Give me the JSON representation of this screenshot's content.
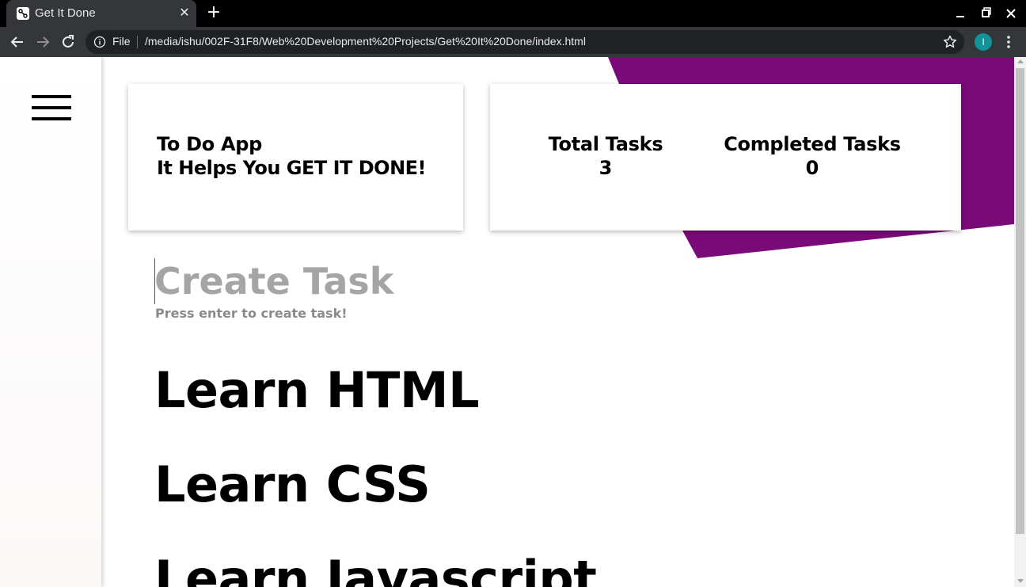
{
  "browser": {
    "tab_title": "Get It Done",
    "tab_close_label": "✕",
    "new_tab_label": "+",
    "file_label": "File",
    "url": "/media/ishu/002F-31F8/Web%20Development%20Projects/Get%20It%20Done/index.html",
    "profile_initial": "I",
    "profile_color": "#12939a"
  },
  "colors": {
    "accent_purple": "#7a0a78",
    "card_bg": "#ffffff",
    "placeholder_gray": "#a5a5a5"
  },
  "intro_card": {
    "title": "To Do App",
    "subtitle": "It Helps You GET IT DONE!"
  },
  "stats": {
    "total_label": "Total Tasks",
    "total_value": "3",
    "completed_label": "Completed Tasks",
    "completed_value": "0"
  },
  "create": {
    "placeholder": "Create Task",
    "hint": "Press enter to create task!"
  },
  "tasks": [
    {
      "label": "Learn HTML"
    },
    {
      "label": "Learn CSS"
    },
    {
      "label": "Learn Javascript"
    }
  ],
  "icons": {
    "menu": "hamburger-menu-icon",
    "back": "back-arrow-icon",
    "forward": "forward-arrow-icon",
    "reload": "reload-icon",
    "info": "info-icon",
    "bookmark": "star-icon",
    "more": "more-vertical-icon"
  }
}
